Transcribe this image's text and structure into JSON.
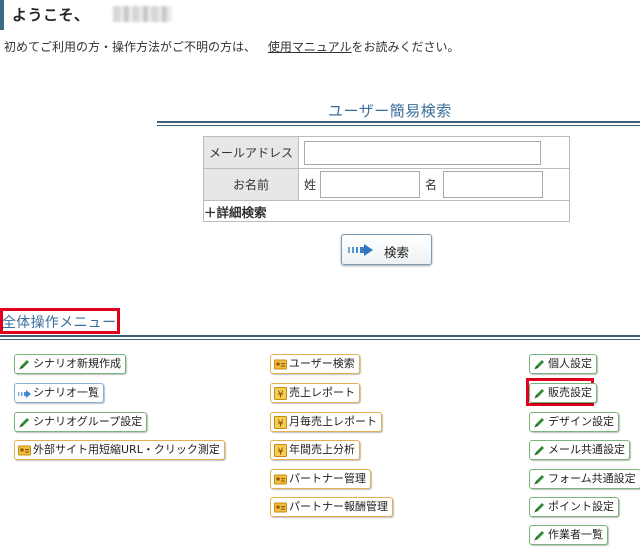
{
  "header": {
    "welcome": "ようこそ、",
    "intro_prefix": "初めてご利用の方・操作方法がご不明の方は、",
    "intro_link": "使用マニュアル",
    "intro_suffix": "をお読みください。"
  },
  "search": {
    "title": "ユーザー簡易検索",
    "email_label": "メールアドレス",
    "name_label": "お名前",
    "last_name_label": "姓",
    "first_name_label": "名",
    "advanced_label": "＋詳細検索",
    "search_button": "検索"
  },
  "menu": {
    "title": "全体操作メニュー",
    "col1": [
      "シナリオ新規作成",
      "シナリオ一覧",
      "シナリオグループ設定",
      "外部サイト用短縮URL・クリック測定"
    ],
    "col2": [
      "ユーザー検索",
      "売上レポート",
      "月毎売上レポート",
      "年間売上分析",
      "パートナー管理",
      "パートナー報酬管理"
    ],
    "col3": [
      "個人設定",
      "販売設定",
      "デザイン設定",
      "メール共通設定",
      "フォーム共通設定",
      "ポイント設定",
      "作業者一覧"
    ]
  },
  "colors": {
    "accent_blue": "#3a6f9c",
    "highlight_red": "#e0001b",
    "rule": "#3d5f78"
  }
}
